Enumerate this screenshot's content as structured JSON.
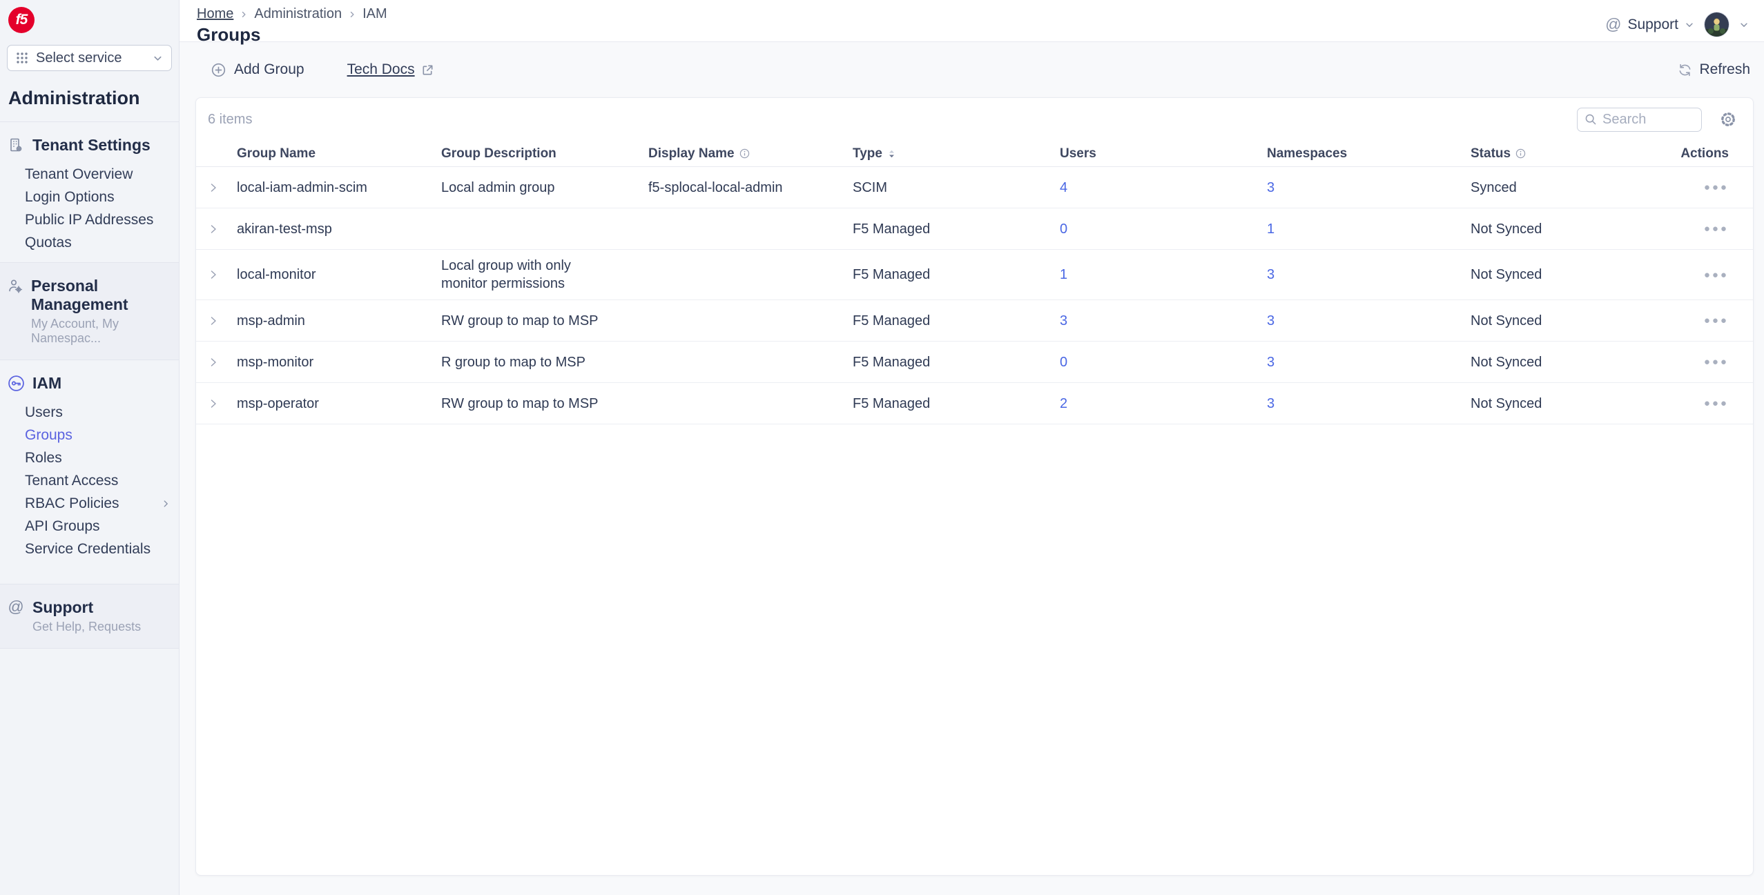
{
  "sidebar": {
    "logo_text": "f5",
    "service_selector": "Select service",
    "title": "Administration",
    "tenant": {
      "label": "Tenant Settings",
      "items": [
        "Tenant Overview",
        "Login Options",
        "Public IP Addresses",
        "Quotas"
      ]
    },
    "personal": {
      "label": "Personal Management",
      "subtitle": "My Account, My Namespac..."
    },
    "iam": {
      "label": "IAM",
      "items": [
        "Users",
        "Groups",
        "Roles",
        "Tenant Access",
        "RBAC Policies",
        "API Groups",
        "Service Credentials"
      ],
      "active_item": "Groups"
    },
    "support": {
      "label": "Support",
      "subtitle": "Get Help, Requests"
    }
  },
  "header": {
    "breadcrumb": {
      "home": "Home",
      "section": "Administration",
      "subsection": "IAM"
    },
    "title": "Groups",
    "support_label": "Support"
  },
  "toolbar": {
    "add_group": "Add Group",
    "tech_docs": "Tech Docs",
    "refresh": "Refresh"
  },
  "table": {
    "items_count": "6 items",
    "search_placeholder": "Search",
    "columns": {
      "name": "Group Name",
      "description": "Group Description",
      "display": "Display Name",
      "type": "Type",
      "users": "Users",
      "namespaces": "Namespaces",
      "status": "Status",
      "actions": "Actions"
    },
    "rows": [
      {
        "name": "local-iam-admin-scim",
        "description": "Local admin group",
        "display": "f5-splocal-local-admin",
        "type": "SCIM",
        "users": "4",
        "namespaces": "3",
        "status": "Synced"
      },
      {
        "name": "akiran-test-msp",
        "description": "",
        "display": "",
        "type": "F5 Managed",
        "users": "0",
        "namespaces": "1",
        "status": "Not Synced"
      },
      {
        "name": "local-monitor",
        "description": "Local group with only monitor permissions",
        "display": "",
        "type": "F5 Managed",
        "users": "1",
        "namespaces": "3",
        "status": "Not Synced"
      },
      {
        "name": "msp-admin",
        "description": "RW group to map to MSP",
        "display": "",
        "type": "F5 Managed",
        "users": "3",
        "namespaces": "3",
        "status": "Not Synced"
      },
      {
        "name": "msp-monitor",
        "description": "R group to map to MSP",
        "display": "",
        "type": "F5 Managed",
        "users": "0",
        "namespaces": "3",
        "status": "Not Synced"
      },
      {
        "name": "msp-operator",
        "description": "RW group to map to MSP",
        "display": "",
        "type": "F5 Managed",
        "users": "2",
        "namespaces": "3",
        "status": "Not Synced"
      }
    ]
  },
  "colors": {
    "brand_red": "#E4002B",
    "link_blue": "#4A67E4",
    "active_nav": "#5B63E0"
  }
}
